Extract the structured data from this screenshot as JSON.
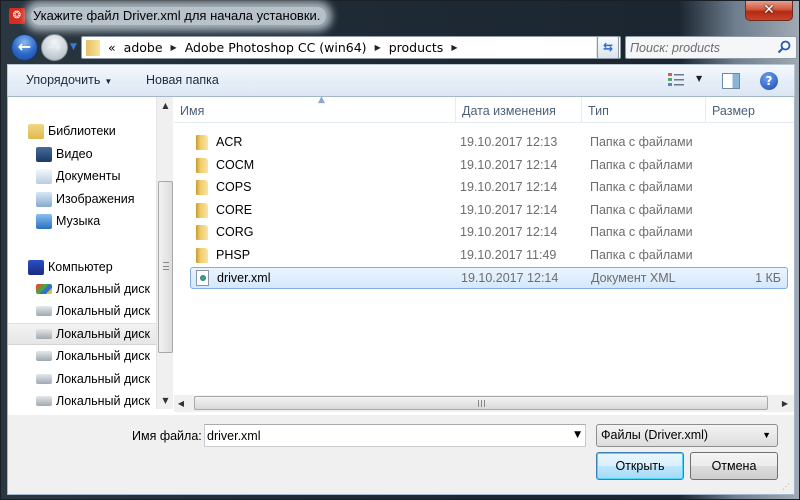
{
  "window": {
    "title": "Укажите файл Driver.xml для начала установки.",
    "app_icon": "adobe-acrobat-icon",
    "close_label": "✕"
  },
  "navbar": {
    "back_label": "←",
    "forward_label": "→",
    "breadcrumb_prefix": "«",
    "breadcrumbs": [
      "adobe",
      "Adobe Photoshop CC (win64)",
      "products"
    ],
    "search_placeholder": "Поиск: products"
  },
  "toolbar": {
    "organize_label": "Упорядочить",
    "new_folder_label": "Новая папка",
    "help_label": "?"
  },
  "sidebar": {
    "items": [
      {
        "label": "Библиотеки",
        "icon": "libraries-icon",
        "level": 0
      },
      {
        "label": "Видео",
        "icon": "video-library-icon",
        "level": 1
      },
      {
        "label": "Документы",
        "icon": "documents-library-icon",
        "level": 1
      },
      {
        "label": "Изображения",
        "icon": "pictures-library-icon",
        "level": 1
      },
      {
        "label": "Музыка",
        "icon": "music-library-icon",
        "level": 1
      },
      {
        "label": "Компьютер",
        "icon": "computer-icon",
        "level": 0
      },
      {
        "label": "Локальный диск",
        "icon": "system-drive-icon",
        "level": 1
      },
      {
        "label": "Локальный диск",
        "icon": "drive-icon",
        "level": 1
      },
      {
        "label": "Локальный диск",
        "icon": "drive-icon",
        "level": 1,
        "selected": true
      },
      {
        "label": "Локальный диск",
        "icon": "drive-icon",
        "level": 1
      },
      {
        "label": "Локальный диск",
        "icon": "drive-icon",
        "level": 1
      },
      {
        "label": "Локальный диск",
        "icon": "drive-icon",
        "level": 1
      }
    ]
  },
  "file_list": {
    "columns": {
      "name": "Имя",
      "date": "Дата изменения",
      "type": "Тип",
      "size": "Размер"
    },
    "rows": [
      {
        "name": "ACR",
        "date": "19.10.2017 12:13",
        "type": "Папка с файлами",
        "size": "",
        "kind": "folder"
      },
      {
        "name": "COCM",
        "date": "19.10.2017 12:14",
        "type": "Папка с файлами",
        "size": "",
        "kind": "folder"
      },
      {
        "name": "COPS",
        "date": "19.10.2017 12:14",
        "type": "Папка с файлами",
        "size": "",
        "kind": "folder"
      },
      {
        "name": "CORE",
        "date": "19.10.2017 12:14",
        "type": "Папка с файлами",
        "size": "",
        "kind": "folder"
      },
      {
        "name": "CORG",
        "date": "19.10.2017 12:14",
        "type": "Папка с файлами",
        "size": "",
        "kind": "folder"
      },
      {
        "name": "PHSP",
        "date": "19.10.2017 11:49",
        "type": "Папка с файлами",
        "size": "",
        "kind": "folder"
      },
      {
        "name": "driver.xml",
        "date": "19.10.2017 12:14",
        "type": "Документ XML",
        "size": "1 КБ",
        "kind": "xml",
        "selected": true
      }
    ]
  },
  "footer": {
    "filename_label": "Имя файла:",
    "filename_value": "driver.xml",
    "filter_value": "Файлы (Driver.xml)",
    "open_label": "Открыть",
    "cancel_label": "Отмена"
  }
}
